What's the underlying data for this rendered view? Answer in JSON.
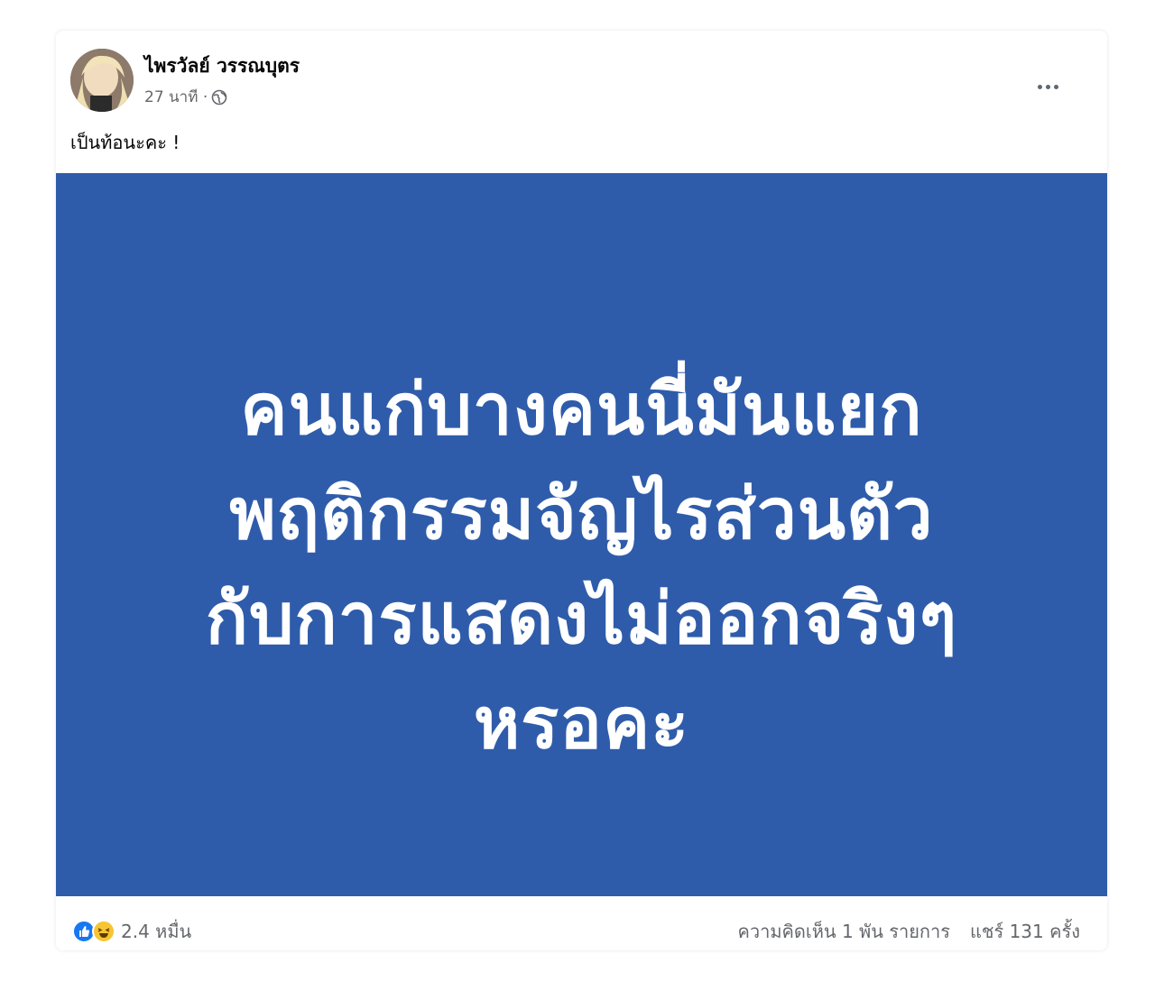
{
  "post": {
    "author": "ไพรวัลย์ วรรณบุตร",
    "time": "27 นาที ·",
    "caption": "เป็นท้อนะคะ !"
  },
  "media": {
    "background_color": "#2f5caa",
    "lines": [
      "คนแก่บางคนนี่มันแยก",
      "พฤติกรรมจัญไรส่วนตัว",
      "กับการแสดงไม่ออกจริงๆ",
      "หรอคะ"
    ]
  },
  "footer": {
    "reaction_count": "2.4 หมื่น",
    "comments": "ความคิดเห็น 1 พัน รายการ",
    "shares": "แชร์ 131 ครั้ง"
  },
  "icons": {
    "more": "more-options-icon",
    "privacy": "globe-icon",
    "reactions": [
      "like-icon",
      "haha-icon"
    ]
  }
}
